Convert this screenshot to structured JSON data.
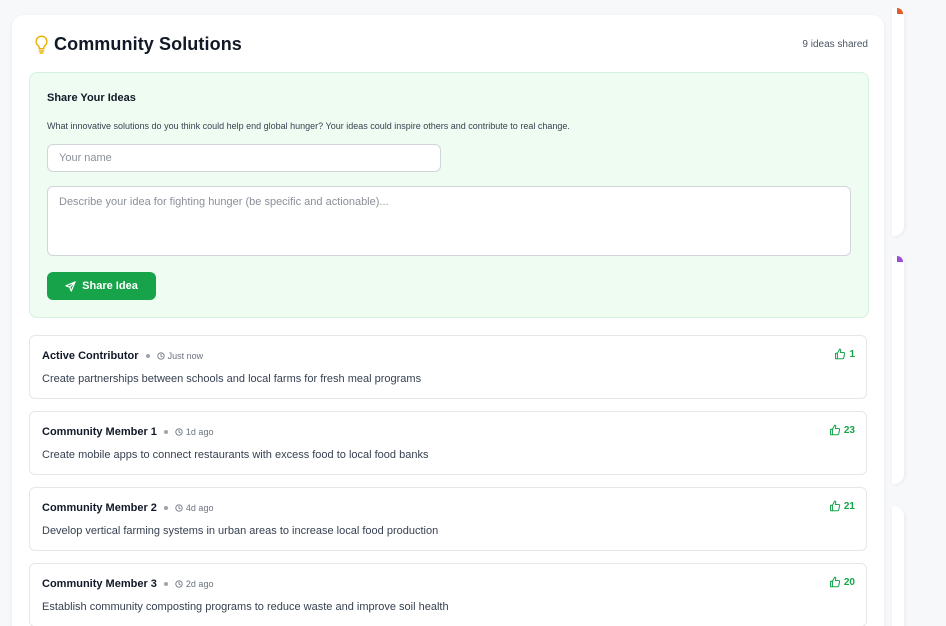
{
  "section": {
    "title": "Community Solutions",
    "icon": "lightbulb-icon",
    "count_text": "9 ideas shared"
  },
  "share_form": {
    "title": "Share Your Ideas",
    "description": "What innovative solutions do you think could help end global hunger? Your ideas could inspire others and contribute to real change.",
    "name_placeholder": "Your name",
    "name_value": "",
    "idea_placeholder": "Describe your idea for fighting hunger (be specific and actionable)...",
    "idea_value": "",
    "submit_label": "Share Idea",
    "submit_icon": "send-icon"
  },
  "ideas": [
    {
      "author": "Active Contributor",
      "time": "Just now",
      "text": "Create partnerships between schools and local farms for fresh meal programs",
      "likes": "1"
    },
    {
      "author": "Community Member 1",
      "time": "1d ago",
      "text": "Create mobile apps to connect restaurants with excess food to local food banks",
      "likes": "23"
    },
    {
      "author": "Community Member 2",
      "time": "4d ago",
      "text": "Develop vertical farming systems in urban areas to increase local food production",
      "likes": "21"
    },
    {
      "author": "Community Member 3",
      "time": "2d ago",
      "text": "Establish community composting programs to reduce waste and improve soil health",
      "likes": "20"
    }
  ],
  "colors": {
    "accent": "#16a34a",
    "panel_bg": "#effcf2",
    "bulb": "#eab308"
  }
}
